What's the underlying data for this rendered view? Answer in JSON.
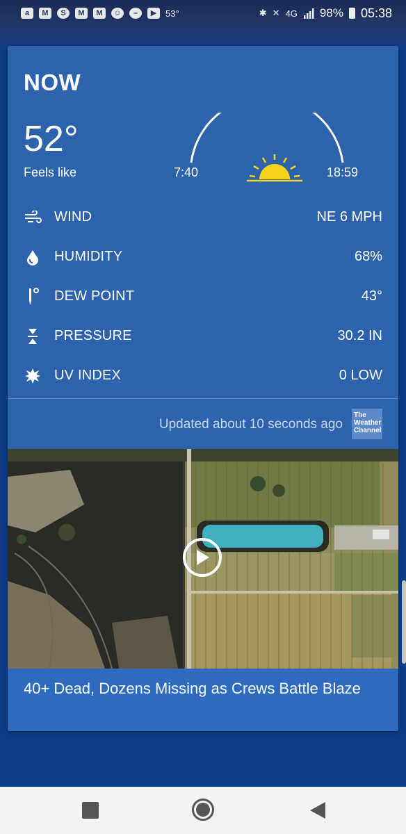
{
  "status_bar": {
    "temperature": "53°",
    "network": "4G",
    "battery": "98%",
    "time": "05:38",
    "left_icons": [
      "amazon-icon",
      "gmail-icon",
      "skype-icon",
      "gmail-icon",
      "gmail-icon",
      "game-icon",
      "do-not-disturb-icon",
      "youtube-icon"
    ],
    "right_icons": [
      "bluetooth-icon",
      "mute-icon",
      "signal-icon",
      "battery-icon"
    ]
  },
  "weather": {
    "section_title": "NOW",
    "temperature": "52°",
    "feels_like_label": "Feels like",
    "sunrise": "7:40",
    "sunset": "18:59",
    "rows": [
      {
        "icon": "wind-icon",
        "label": "WIND",
        "value": "NE 6 MPH"
      },
      {
        "icon": "humidity-icon",
        "label": "HUMIDITY",
        "value": "68%"
      },
      {
        "icon": "dew-point-icon",
        "label": "DEW POINT",
        "value": "43°"
      },
      {
        "icon": "pressure-icon",
        "label": "PRESSURE",
        "value": "30.2 IN"
      },
      {
        "icon": "uv-index-icon",
        "label": "UV INDEX",
        "value": "0 LOW"
      }
    ],
    "updated": "Updated about 10 seconds ago",
    "provider_logo_text": "The Weather Channel"
  },
  "news": {
    "headline": "40+ Dead, Dozens Missing as Crews Battle Blaze",
    "media": "aerial-wildfire-vineyard-image"
  },
  "colors": {
    "card_bg": "#2d62ad",
    "page_bg": "#0d3d86",
    "sun": "#f5d31d"
  }
}
